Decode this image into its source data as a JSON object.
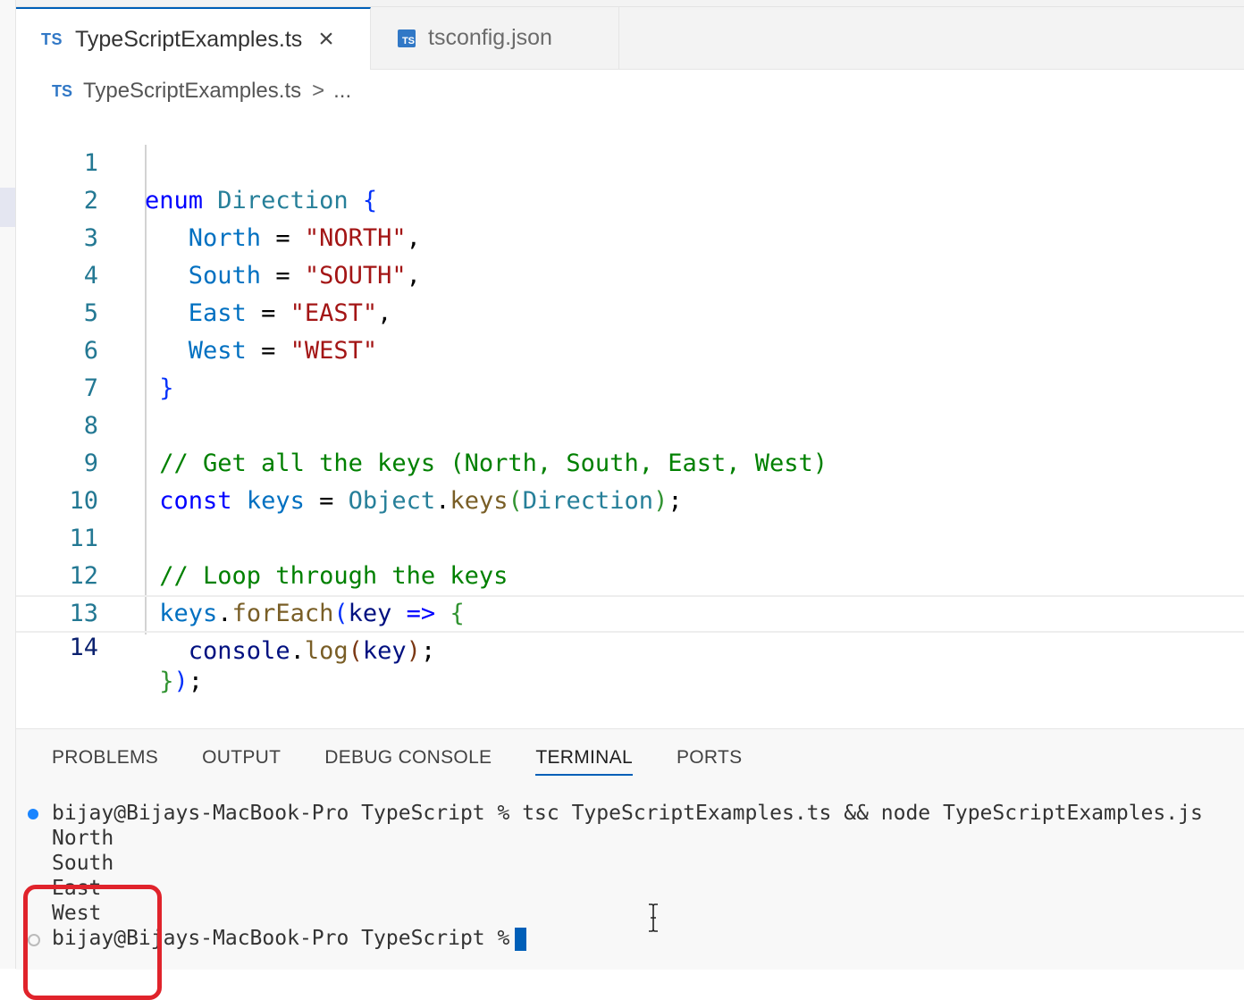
{
  "tabs": [
    {
      "badge": "TS",
      "label": "TypeScriptExamples.ts",
      "close": "×"
    },
    {
      "badge": "TS",
      "label": "tsconfig.json"
    }
  ],
  "breadcrumb": {
    "badge": "TS",
    "file": "TypeScriptExamples.ts",
    "separator": ">",
    "more": "..."
  },
  "editor": {
    "line_numbers": [
      "1",
      "2",
      "3",
      "4",
      "5",
      "6",
      "7",
      "8",
      "9",
      "10",
      "11",
      "12",
      "13",
      "14"
    ],
    "current_line": "14",
    "lines": {
      "l1": {
        "kw": "enum",
        "name": "Direction",
        "brace": "{"
      },
      "l2": {
        "member": "North",
        "eq": "=",
        "value": "\"NORTH\"",
        "comma": ","
      },
      "l3": {
        "member": "South",
        "eq": "=",
        "value": "\"SOUTH\"",
        "comma": ","
      },
      "l4": {
        "member": "East",
        "eq": "=",
        "value": "\"EAST\"",
        "comma": ","
      },
      "l5": {
        "member": "West",
        "eq": "=",
        "value": "\"WEST\""
      },
      "l6": {
        "brace": "}"
      },
      "l8": {
        "comment": "// Get all the keys (North, South, East, West)"
      },
      "l9": {
        "kw": "const",
        "var": "keys",
        "eq": "=",
        "obj": "Object",
        "dot": ".",
        "fn": "keys",
        "open": "(",
        "arg": "Direction",
        "close": ")",
        "semi": ";"
      },
      "l11": {
        "comment": "// Loop through the keys"
      },
      "l12": {
        "var": "keys",
        "dot": ".",
        "fn": "forEach",
        "open": "(",
        "param": "key",
        "arrow": "=>",
        "brace": "{"
      },
      "l13": {
        "obj": "console",
        "dot": ".",
        "fn": "log",
        "open": "(",
        "arg": "key",
        "close": ")",
        "semi": ";"
      },
      "l14": {
        "brace": "}",
        "close": ")",
        "semi": ";"
      }
    }
  },
  "panel": {
    "tabs": [
      "PROBLEMS",
      "OUTPUT",
      "DEBUG CONSOLE",
      "TERMINAL",
      "PORTS"
    ],
    "active_tab": "TERMINAL",
    "terminal": {
      "command_line": "bijay@Bijays-MacBook-Pro TypeScript % tsc TypeScriptExamples.ts && node TypeScriptExamples.js",
      "output": [
        "North",
        "South",
        "East",
        "West"
      ],
      "prompt": "bijay@Bijays-MacBook-Pro TypeScript %"
    }
  },
  "colors": {
    "accent": "#005fb8",
    "highlight_box": "#e0232b",
    "keyword": "#0000ff",
    "string": "#a31515",
    "comment": "#008000"
  }
}
